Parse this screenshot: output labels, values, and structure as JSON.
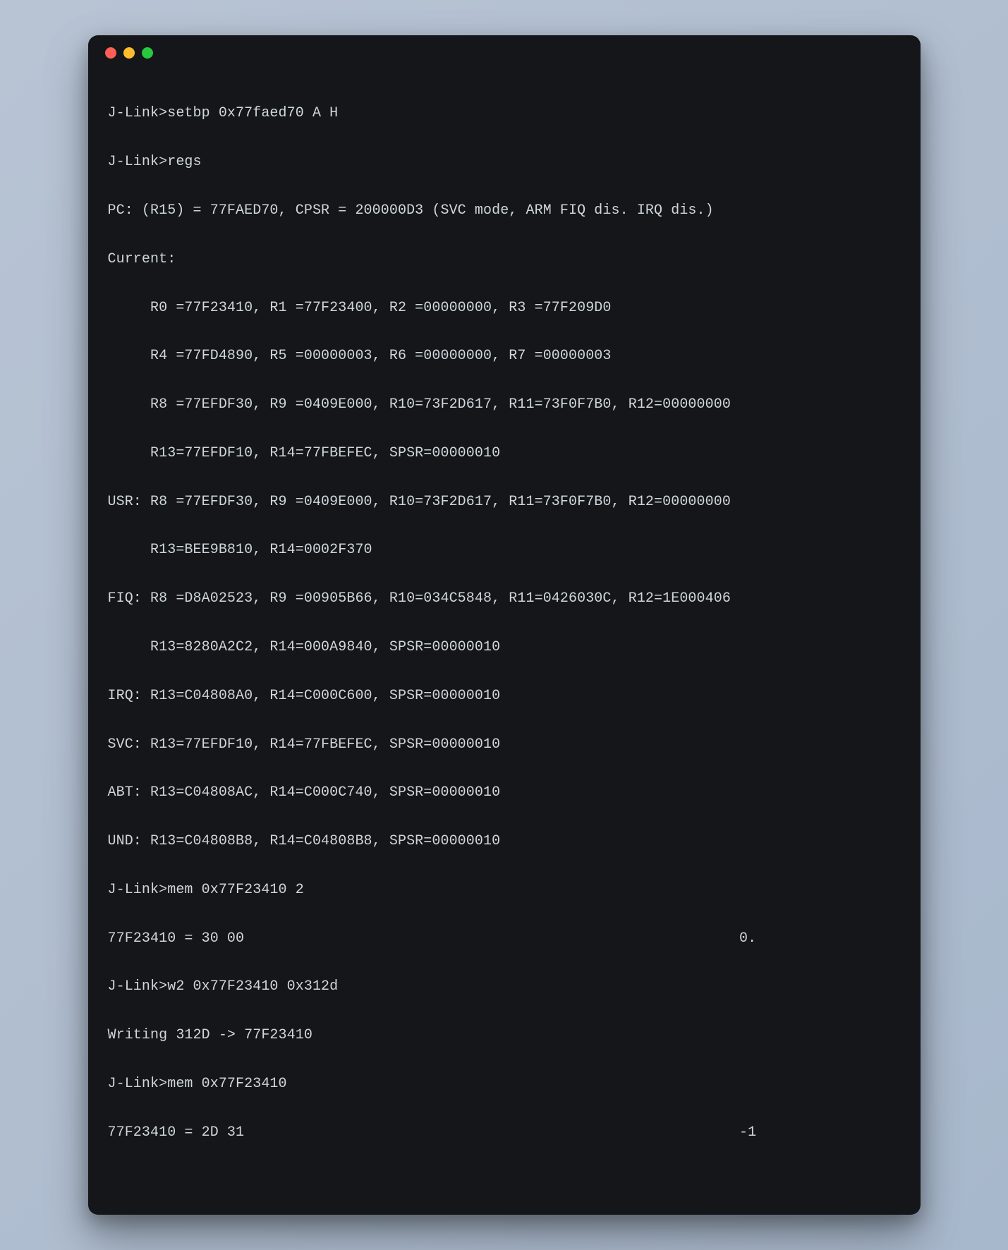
{
  "titlebar": {
    "close_label": "close",
    "minimize_label": "minimize",
    "maximize_label": "maximize"
  },
  "terminal": {
    "lines": [
      "J-Link>setbp 0x77faed70 A H",
      "J-Link>regs",
      "PC: (R15) = 77FAED70, CPSR = 200000D3 (SVC mode, ARM FIQ dis. IRQ dis.)",
      "Current:",
      "     R0 =77F23410, R1 =77F23400, R2 =00000000, R3 =77F209D0",
      "     R4 =77FD4890, R5 =00000003, R6 =00000000, R7 =00000003",
      "     R8 =77EFDF30, R9 =0409E000, R10=73F2D617, R11=73F0F7B0, R12=00000000",
      "     R13=77EFDF10, R14=77FBEFEC, SPSR=00000010",
      "USR: R8 =77EFDF30, R9 =0409E000, R10=73F2D617, R11=73F0F7B0, R12=00000000",
      "     R13=BEE9B810, R14=0002F370",
      "FIQ: R8 =D8A02523, R9 =00905B66, R10=034C5848, R11=0426030C, R12=1E000406",
      "     R13=8280A2C2, R14=000A9840, SPSR=00000010",
      "IRQ: R13=C04808A0, R14=C000C600, SPSR=00000010",
      "SVC: R13=77EFDF10, R14=77FBEFEC, SPSR=00000010",
      "ABT: R13=C04808AC, R14=C000C740, SPSR=00000010",
      "UND: R13=C04808B8, R14=C04808B8, SPSR=00000010",
      "J-Link>mem 0x77F23410 2",
      "77F23410 = 30 00                                                          0.",
      "J-Link>w2 0x77F23410 0x312d",
      "Writing 312D -> 77F23410",
      "J-Link>mem 0x77F23410",
      "77F23410 = 2D 31                                                          -1"
    ]
  }
}
